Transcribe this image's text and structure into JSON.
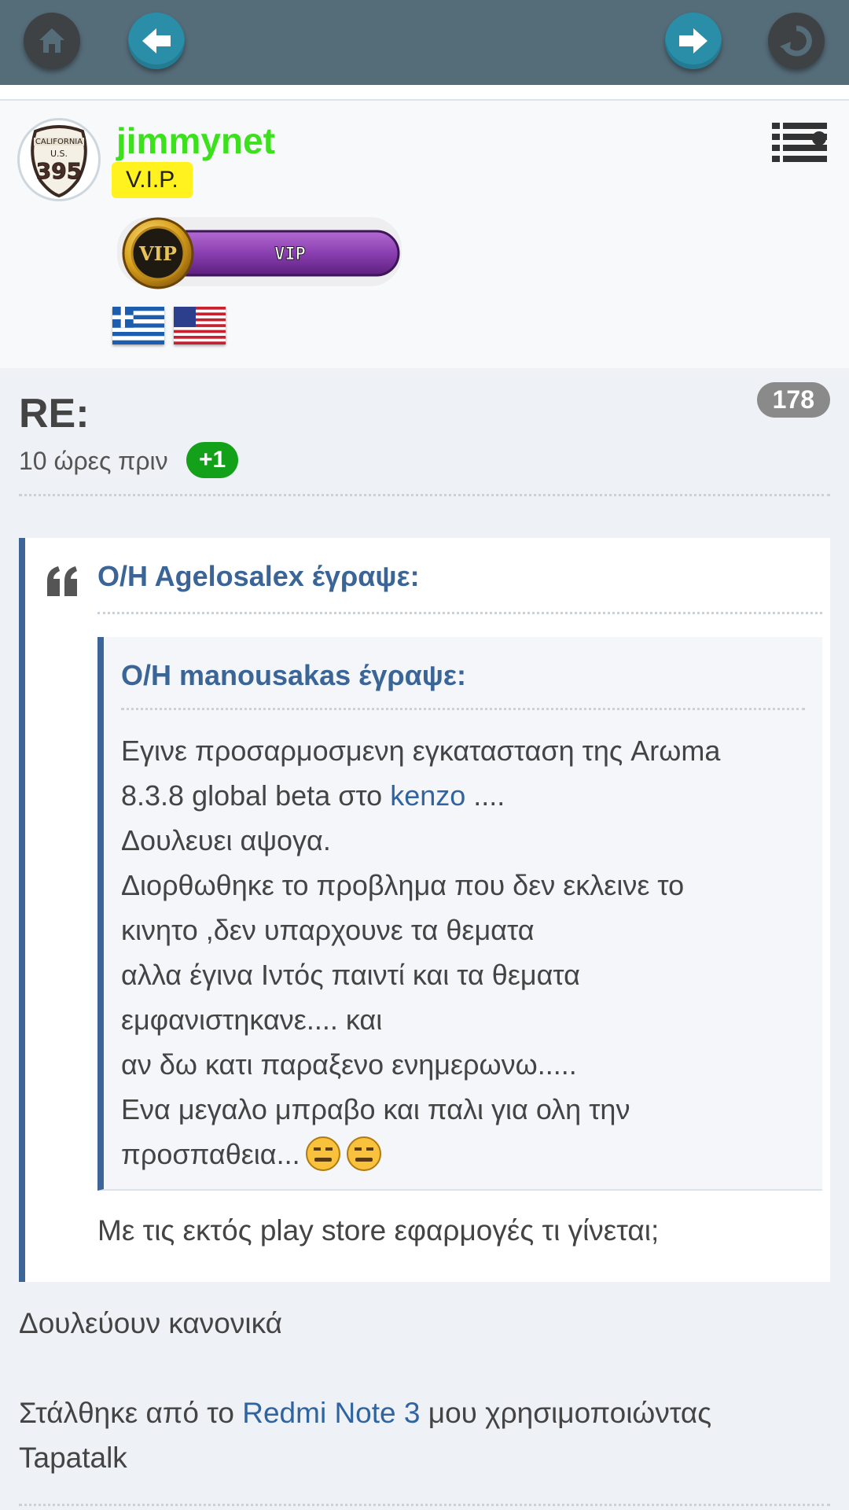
{
  "toolbar": {
    "home_icon": "home-icon",
    "back_icon": "arrow-left-icon",
    "forward_icon": "arrow-right-icon",
    "refresh_icon": "refresh-icon"
  },
  "user": {
    "name": "jimmynet",
    "rank": "V.I.P.",
    "badge_text": "VIP",
    "badge_medal_text": "VIP",
    "avatar_text_top": "CALIFORNIA",
    "avatar_text_mid": "U.S.",
    "avatar_text_num": "395",
    "flags": [
      "greece-flag",
      "usa-flag"
    ]
  },
  "post": {
    "title": "RE:",
    "count": "178",
    "time": "10 ώρες πριν",
    "plus": "+1",
    "quote": {
      "author": "O/H Agelosalex έγραψε:",
      "inner": {
        "author": "O/H manousakas έγραψε:",
        "line1": "Εγινε προσαρμοσμενη εγκατασταση της Arωma",
        "line2_pre": "8.3.8 global beta στο ",
        "line2_link": "kenzo",
        "line2_post": " ....",
        "line3": "Δουλευει αψογα.",
        "line4": "Διορθωθηκε το προβλημα που δεν εκλεινε το",
        "line5": "κινητο ,δεν υπαρχουνε τα θεματα",
        "line6": "αλλα έγινα Ιντός παιντί και τα θεματα",
        "line7": "εμφανιστηκανε.... και",
        "line8": "αν δω κατι παραξενο ενημερωνω.....",
        "line9": "Ενα μεγαλο μπραβο και παλι για ολη την",
        "line10": "προσπαθεια..."
      },
      "reply": "Με τις εκτός play store εφαρμογές τι γίνεται;"
    },
    "answer": "Δουλεύουν κανονικά",
    "signature_pre": "Στάλθηκε από το ",
    "signature_link": "Redmi Note 3",
    "signature_post": " μου χρησιμοποιώντας",
    "signature_line2": "Tapatalk"
  },
  "colors": {
    "toolbar": "#556c79",
    "username": "#3be21c",
    "vip_tag": "#fff21f",
    "quote_border": "#3d6597",
    "link": "#2f64a0",
    "plus_badge": "#14a11a"
  }
}
